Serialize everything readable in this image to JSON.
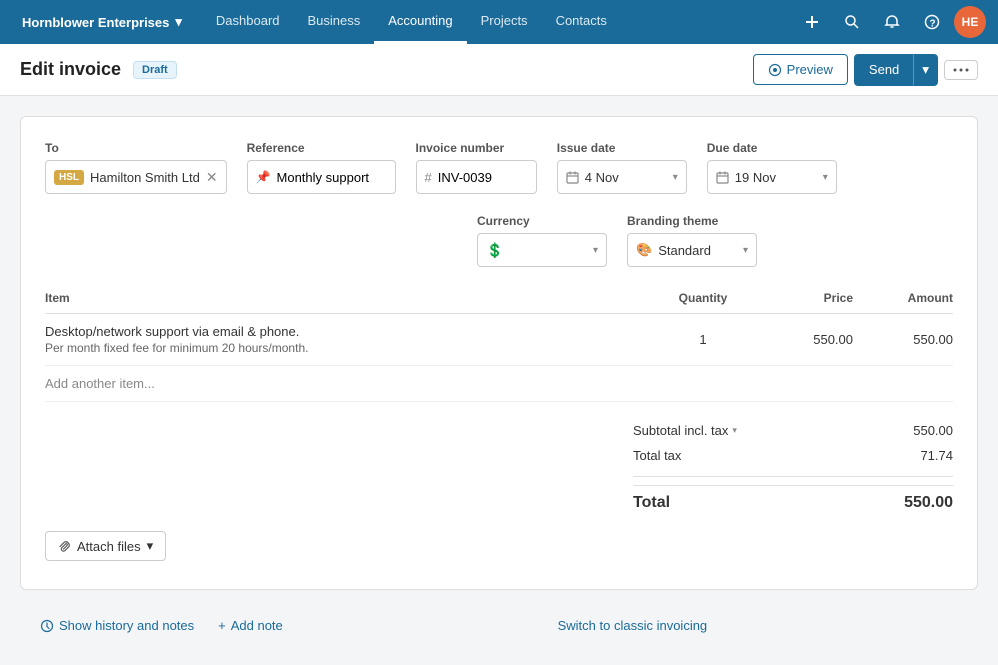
{
  "app": {
    "org_name": "Hornblower Enterprises",
    "org_dropdown_icon": "▾"
  },
  "nav": {
    "links": [
      {
        "label": "Dashboard",
        "active": false
      },
      {
        "label": "Business",
        "active": false
      },
      {
        "label": "Accounting",
        "active": true
      },
      {
        "label": "Projects",
        "active": false
      },
      {
        "label": "Contacts",
        "active": false
      }
    ],
    "add_icon": "+",
    "search_icon": "🔍",
    "bell_icon": "🔔",
    "help_icon": "?",
    "avatar_initials": "HE"
  },
  "page": {
    "title": "Edit invoice",
    "status_badge": "Draft"
  },
  "toolbar": {
    "preview_label": "Preview",
    "send_label": "Send",
    "more_icon": "•••"
  },
  "form": {
    "to_label": "To",
    "to_contact_badge": "HSL",
    "to_contact_name": "Hamilton Smith Ltd",
    "ref_label": "Reference",
    "ref_value": "Monthly support",
    "ref_placeholder": "Monthly support",
    "inv_num_label": "Invoice number",
    "inv_num_value": "INV-0039",
    "issue_date_label": "Issue date",
    "issue_date_value": "4 Nov",
    "due_date_label": "Due date",
    "due_date_value": "19 Nov",
    "currency_label": "Currency",
    "currency_symbol": "💲",
    "branding_label": "Branding theme",
    "branding_icon": "🎨",
    "branding_value": "Standard"
  },
  "line_items": {
    "headers": {
      "item": "Item",
      "quantity": "Quantity",
      "price": "Price",
      "amount": "Amount"
    },
    "rows": [
      {
        "desc_line1": "Desktop/network support via email & phone.",
        "desc_line2": "Per month fixed fee for minimum 20 hours/month.",
        "quantity": "1",
        "price": "550.00",
        "amount": "550.00"
      }
    ],
    "add_item_label": "Add another item..."
  },
  "totals": {
    "subtotal_label": "Subtotal incl. tax",
    "subtotal_value": "550.00",
    "tax_label": "Total tax",
    "tax_value": "71.74",
    "total_label": "Total",
    "total_value": "550.00"
  },
  "attachments": {
    "attach_label": "Attach files",
    "attach_caret": "▾"
  },
  "footer": {
    "history_icon": "↺",
    "history_label": "Show history and notes",
    "add_note_icon": "+",
    "add_note_label": "Add note",
    "classic_label": "Switch to classic invoicing"
  }
}
